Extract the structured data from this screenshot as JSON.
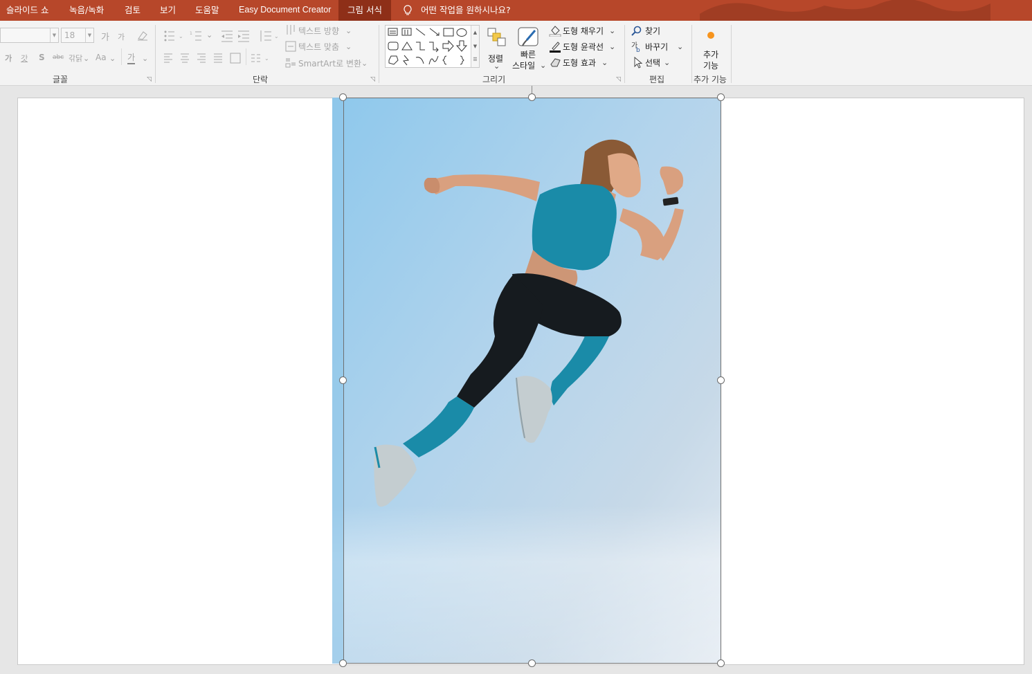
{
  "tabs": [
    {
      "label": "슬라이드 쇼"
    },
    {
      "label": "녹음/녹화"
    },
    {
      "label": "검토"
    },
    {
      "label": "보기"
    },
    {
      "label": "도움말"
    },
    {
      "label": "Easy Document Creator"
    },
    {
      "label": "그림 서식",
      "active": true
    }
  ],
  "tell_me": "어떤 작업을 원하시나요?",
  "ribbon": {
    "font": {
      "label": "글꼴",
      "size_value": "18",
      "grow_glyph": "가",
      "shrink_glyph": "가",
      "bold_glyph": "가",
      "underline_glyph": "갓",
      "shadow_glyph": "S",
      "strike_glyph": "abc",
      "spacing_glyph": "갂닭",
      "case_glyph": "Aa",
      "color_glyph": "가"
    },
    "paragraph": {
      "label": "단락",
      "text_direction": "텍스트 방향",
      "align_text": "텍스트 맞춤",
      "smartart": "SmartArt로 변환"
    },
    "drawing": {
      "label": "그리기",
      "arrange_line1": "정렬",
      "quick_styles_line1": "빠른",
      "quick_styles_line2": "스타일",
      "shape_fill": "도형 채우기",
      "shape_outline": "도형 윤곽선",
      "shape_effects": "도형 효과"
    },
    "editing": {
      "label": "편집",
      "find": "찾기",
      "replace": "바꾸기",
      "select": "선택"
    },
    "addins": {
      "label": "추가 기능",
      "button_line1": "추가",
      "button_line2": "기능"
    }
  },
  "colors": {
    "tab_bar": "#b7472a",
    "tab_active": "#8e2f18",
    "ribbon_bg": "#f3f3f3",
    "workspace_bg": "#e6e6e6",
    "addin_dot": "#f7941d"
  },
  "icons": [
    "lightbulb-icon",
    "find-icon",
    "replace-icon",
    "select-icon",
    "shape-fill-icon",
    "shape-outline-icon",
    "shape-effects-icon",
    "arrange-icon",
    "quick-styles-icon",
    "addin-icon"
  ]
}
